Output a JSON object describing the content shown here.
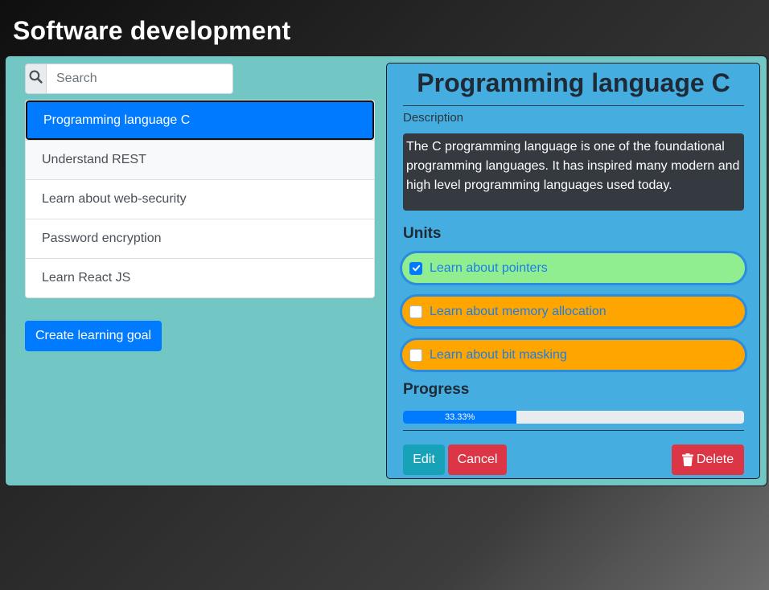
{
  "header": {
    "title": "Software development"
  },
  "search": {
    "placeholder": "Search",
    "value": ""
  },
  "goals": {
    "items": [
      {
        "label": "Programming language C",
        "active": true
      },
      {
        "label": "Understand REST"
      },
      {
        "label": "Learn about web-security"
      },
      {
        "label": "Password encryption"
      },
      {
        "label": "Learn React JS"
      }
    ],
    "create_label": "Create learning goal"
  },
  "detail": {
    "title": "Programming language C",
    "description_label": "Description",
    "description": "The C programming language is one of the foundational programming languages. It has inspired many modern and high level programming languages used today.",
    "units_label": "Units",
    "units": [
      {
        "label": "Learn about pointers",
        "checked": true,
        "color": "#90ee90"
      },
      {
        "label": "Learn about memory allocation",
        "checked": false,
        "color": "#ffa500"
      },
      {
        "label": "Learn about bit masking",
        "checked": false,
        "color": "#ffa500"
      }
    ],
    "progress_label": "Progress",
    "progress_value": 33.33,
    "progress_text": "33.33%",
    "edit_label": "Edit",
    "cancel_label": "Cancel",
    "delete_label": "Delete"
  },
  "colors": {
    "primary": "#007bff",
    "danger": "#dc3545",
    "info": "#17a2b8",
    "panel_teal": "#72c7c5",
    "panel_blue": "#46ade0"
  },
  "icons": {
    "search": "search-icon",
    "check": "check-icon",
    "delete": "trash-icon"
  }
}
